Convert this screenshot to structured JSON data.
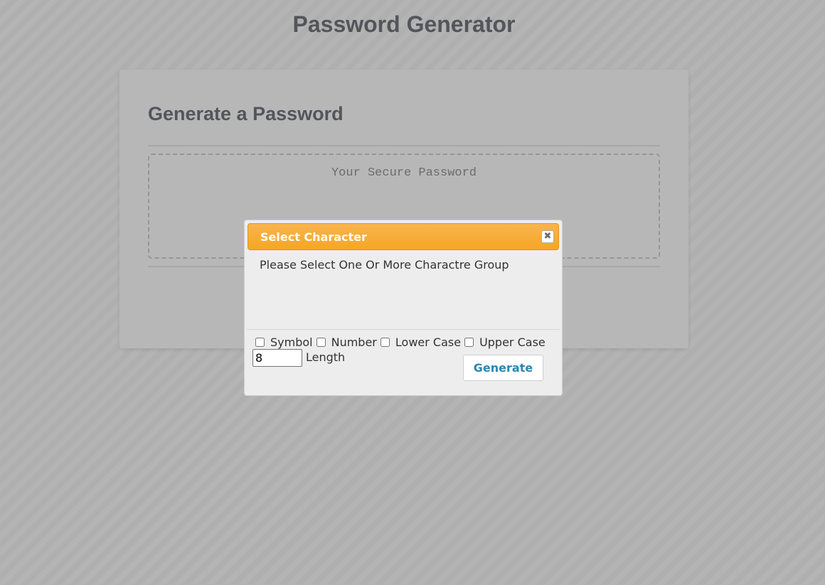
{
  "page": {
    "title": "Password Generator"
  },
  "card": {
    "title": "Generate a Password",
    "password_placeholder": "Your Secure Password"
  },
  "dialog": {
    "title": "Select Character",
    "close_icon": "close-icon",
    "message": "Please Select One Or More Charactre Group",
    "options": [
      {
        "label": "Symbol",
        "checked": false
      },
      {
        "label": "Number",
        "checked": false
      },
      {
        "label": "Lower Case",
        "checked": false
      },
      {
        "label": "Upper Case",
        "checked": false
      }
    ],
    "length_value": "8",
    "length_label": "Length",
    "generate_label": "Generate"
  },
  "colors": {
    "titlebar": "#f5a623",
    "button_text": "#2c86b1",
    "heading_text": "#4a4e55"
  }
}
